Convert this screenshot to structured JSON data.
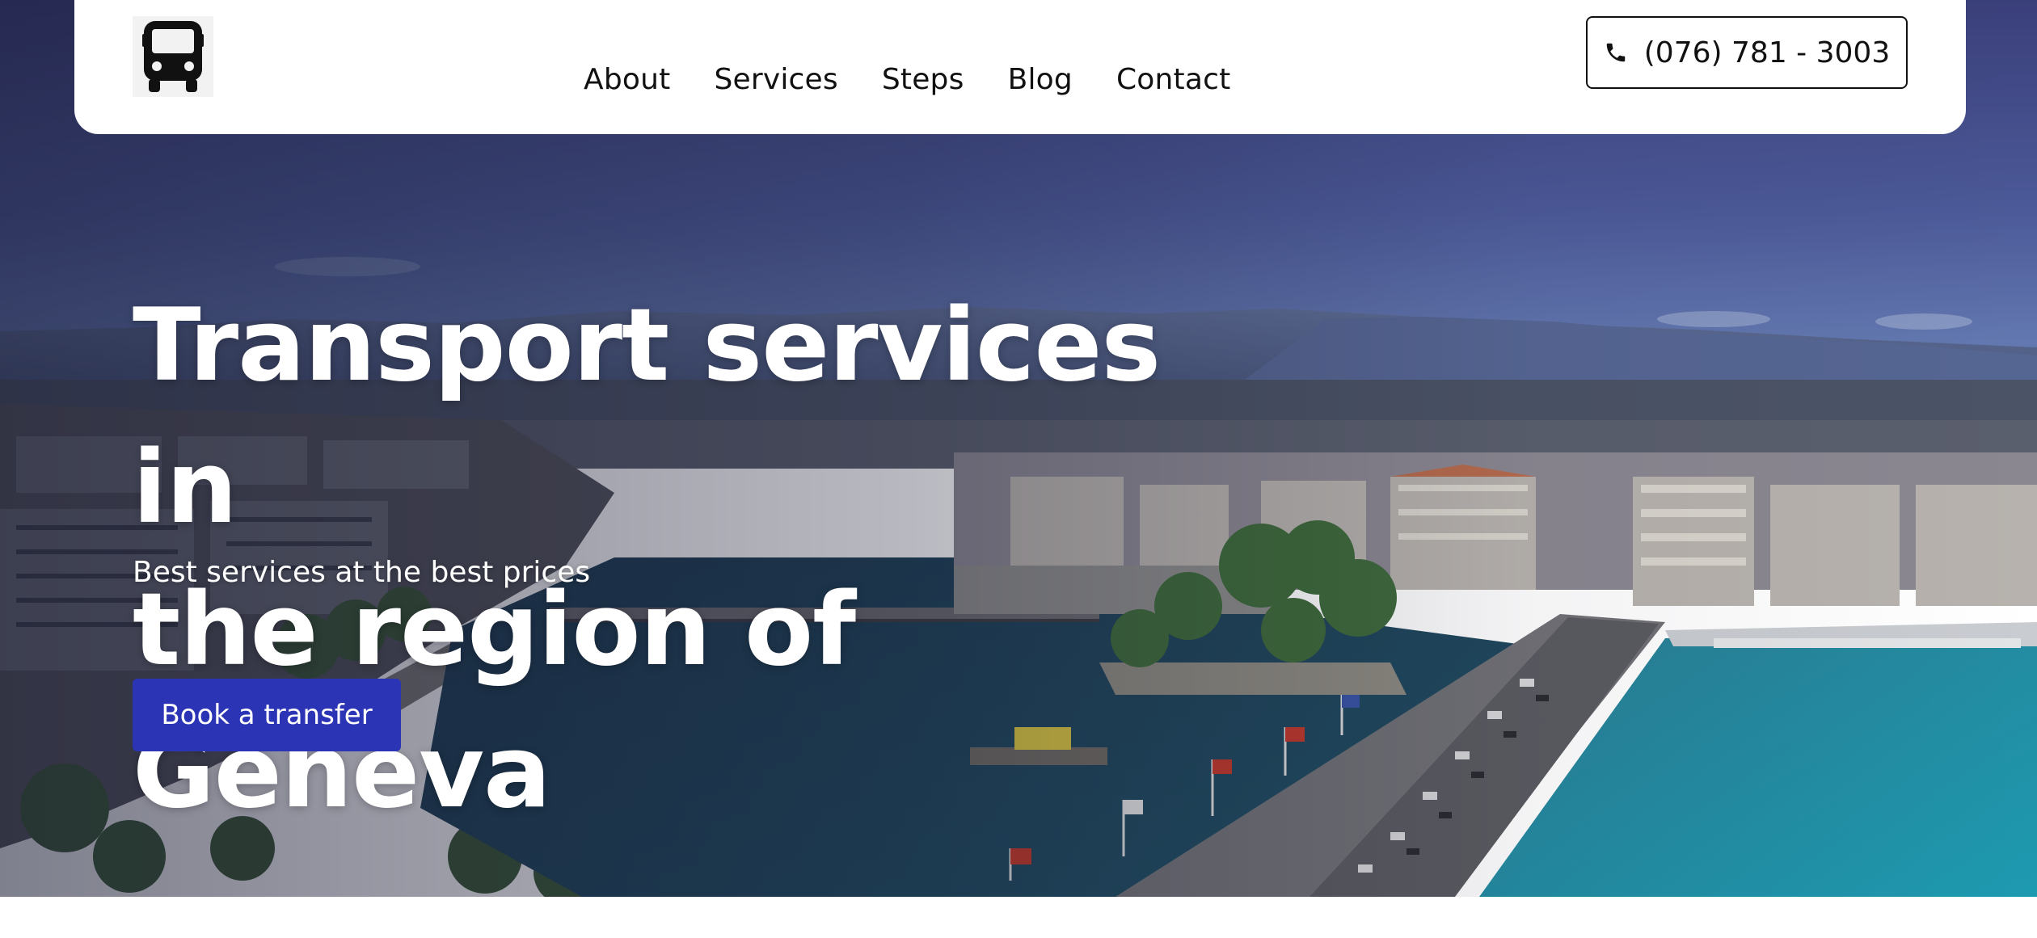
{
  "header": {
    "logo_icon": "bus-icon",
    "nav": [
      {
        "label": "About"
      },
      {
        "label": "Services"
      },
      {
        "label": "Steps"
      },
      {
        "label": "Blog"
      },
      {
        "label": "Contact"
      }
    ],
    "phone": {
      "icon": "phone-icon",
      "label": "(076) 781 - 3003"
    }
  },
  "hero": {
    "title_line1": "Transport services in",
    "title_line2": "the region of Geneva",
    "subtitle": "Best services at the best prices",
    "cta_label": "Book a transfer",
    "background_image": "aerial-view-of-geneva-lake-and-bridge"
  },
  "colors": {
    "accent": "#2b34b5",
    "navbar_bg": "#ffffff",
    "text_dark": "#111111",
    "text_light": "#ffffff"
  }
}
